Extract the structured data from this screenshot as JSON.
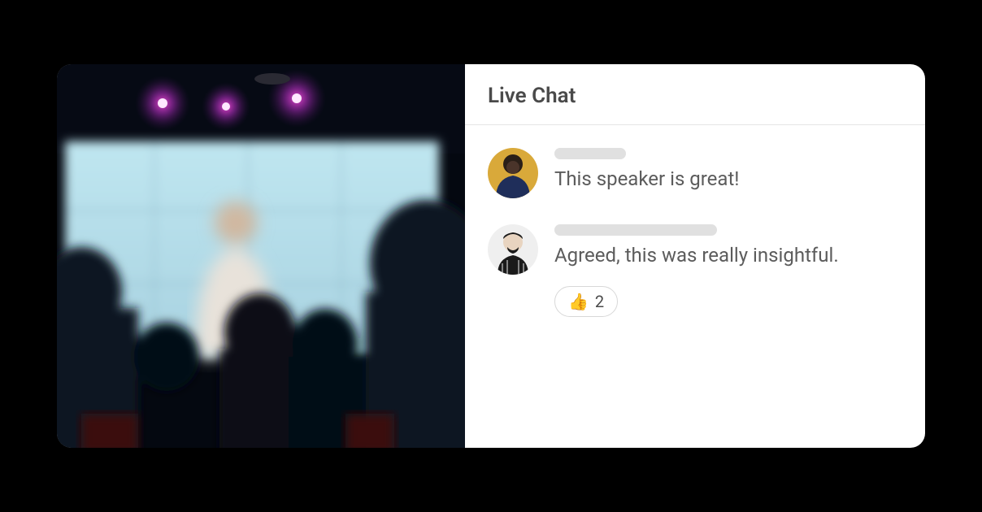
{
  "chat": {
    "title": "Live Chat",
    "messages": [
      {
        "text": "This speaker is great!"
      },
      {
        "text": "Agreed, this was really insightful."
      }
    ],
    "reaction": {
      "emoji": "👍",
      "count": "2"
    }
  }
}
